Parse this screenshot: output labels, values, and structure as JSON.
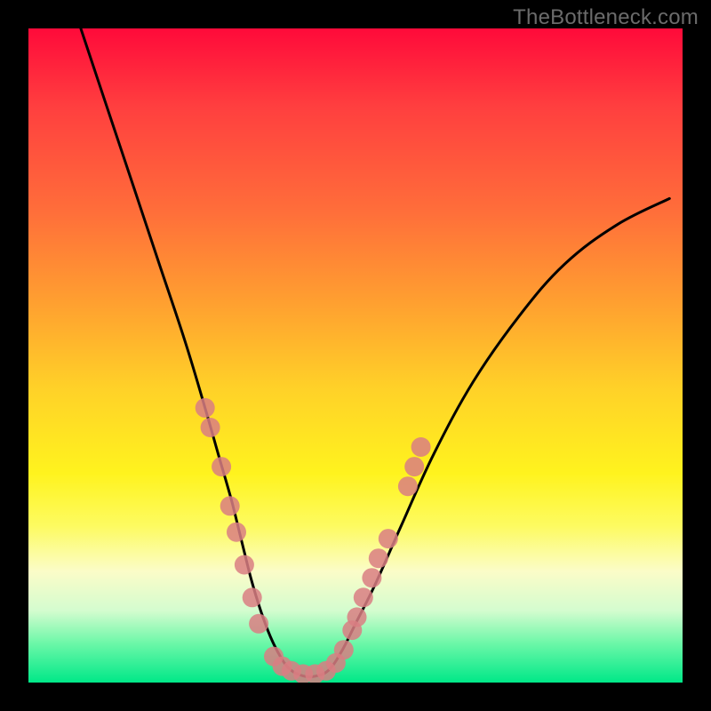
{
  "watermark": "TheBottleneck.com",
  "chart_data": {
    "type": "line",
    "title": "",
    "xlabel": "",
    "ylabel": "",
    "xlim": [
      0,
      100
    ],
    "ylim": [
      0,
      100
    ],
    "series": [
      {
        "name": "curve",
        "x": [
          8,
          12,
          16,
          20,
          24,
          27,
          29,
          31,
          32.5,
          34,
          35.5,
          37,
          38.5,
          40,
          42,
          44,
          46,
          48,
          50,
          53,
          57,
          62,
          68,
          75,
          82,
          90,
          98
        ],
        "y": [
          100,
          88,
          76,
          64,
          52,
          42,
          35,
          28,
          22,
          16,
          11,
          7,
          4,
          2,
          1,
          1,
          2,
          5,
          9,
          15,
          24,
          35,
          46,
          56,
          64,
          70,
          74
        ]
      }
    ],
    "markers": [
      {
        "x": 27.0,
        "y": 42
      },
      {
        "x": 27.8,
        "y": 39
      },
      {
        "x": 29.5,
        "y": 33
      },
      {
        "x": 30.8,
        "y": 27
      },
      {
        "x": 31.8,
        "y": 23
      },
      {
        "x": 33.0,
        "y": 18
      },
      {
        "x": 34.2,
        "y": 13
      },
      {
        "x": 35.2,
        "y": 9
      },
      {
        "x": 37.5,
        "y": 4
      },
      {
        "x": 38.8,
        "y": 2.5
      },
      {
        "x": 40.2,
        "y": 1.8
      },
      {
        "x": 42.0,
        "y": 1.3
      },
      {
        "x": 43.8,
        "y": 1.3
      },
      {
        "x": 45.5,
        "y": 1.8
      },
      {
        "x": 47.0,
        "y": 3
      },
      {
        "x": 48.2,
        "y": 5
      },
      {
        "x": 49.5,
        "y": 8
      },
      {
        "x": 50.2,
        "y": 10
      },
      {
        "x": 51.2,
        "y": 13
      },
      {
        "x": 52.5,
        "y": 16
      },
      {
        "x": 53.5,
        "y": 19
      },
      {
        "x": 55.0,
        "y": 22
      },
      {
        "x": 58.0,
        "y": 30
      },
      {
        "x": 59.0,
        "y": 33
      },
      {
        "x": 60.0,
        "y": 36
      }
    ],
    "grid": false,
    "legend": false
  }
}
